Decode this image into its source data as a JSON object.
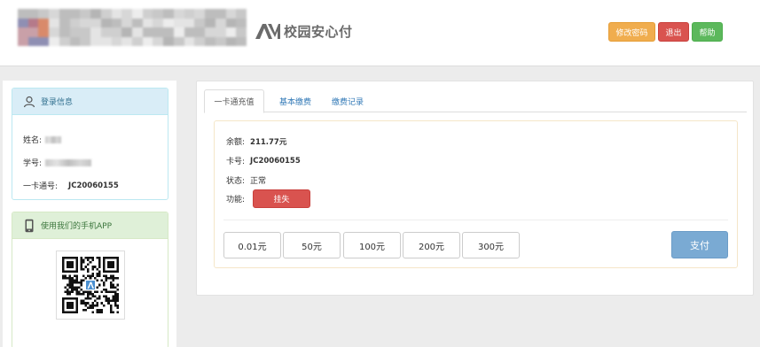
{
  "header": {
    "brand_text": "校园安心付",
    "buttons": {
      "change_password": "修改密码",
      "logout": "退出",
      "help": "帮助"
    }
  },
  "login_panel": {
    "title": "登录信息",
    "name_label": "姓名:",
    "student_id_label": "学号:",
    "card_label": "一卡通号:",
    "card_number": "JC20060155"
  },
  "app_panel": {
    "title": "使用我们的手机APP"
  },
  "tabs": [
    {
      "label": "一卡通充值"
    },
    {
      "label": "基本缴费"
    },
    {
      "label": "缴费记录"
    }
  ],
  "account": {
    "balance_label": "余额:",
    "balance_value": "211.77元",
    "card_label": "卡号:",
    "card_value": "JC20060155",
    "status_label": "状态:",
    "status_value": "正常",
    "function_label": "功能:",
    "report_lost_button": "挂失"
  },
  "amounts": [
    "0.01元",
    "50元",
    "100元",
    "200元",
    "300元"
  ],
  "pay_button": "支付",
  "colors": {
    "warning": "#f0ad4e",
    "danger": "#d9534f",
    "success": "#5cb85c",
    "pay": "#7aaad3",
    "link": "#337ab7"
  }
}
